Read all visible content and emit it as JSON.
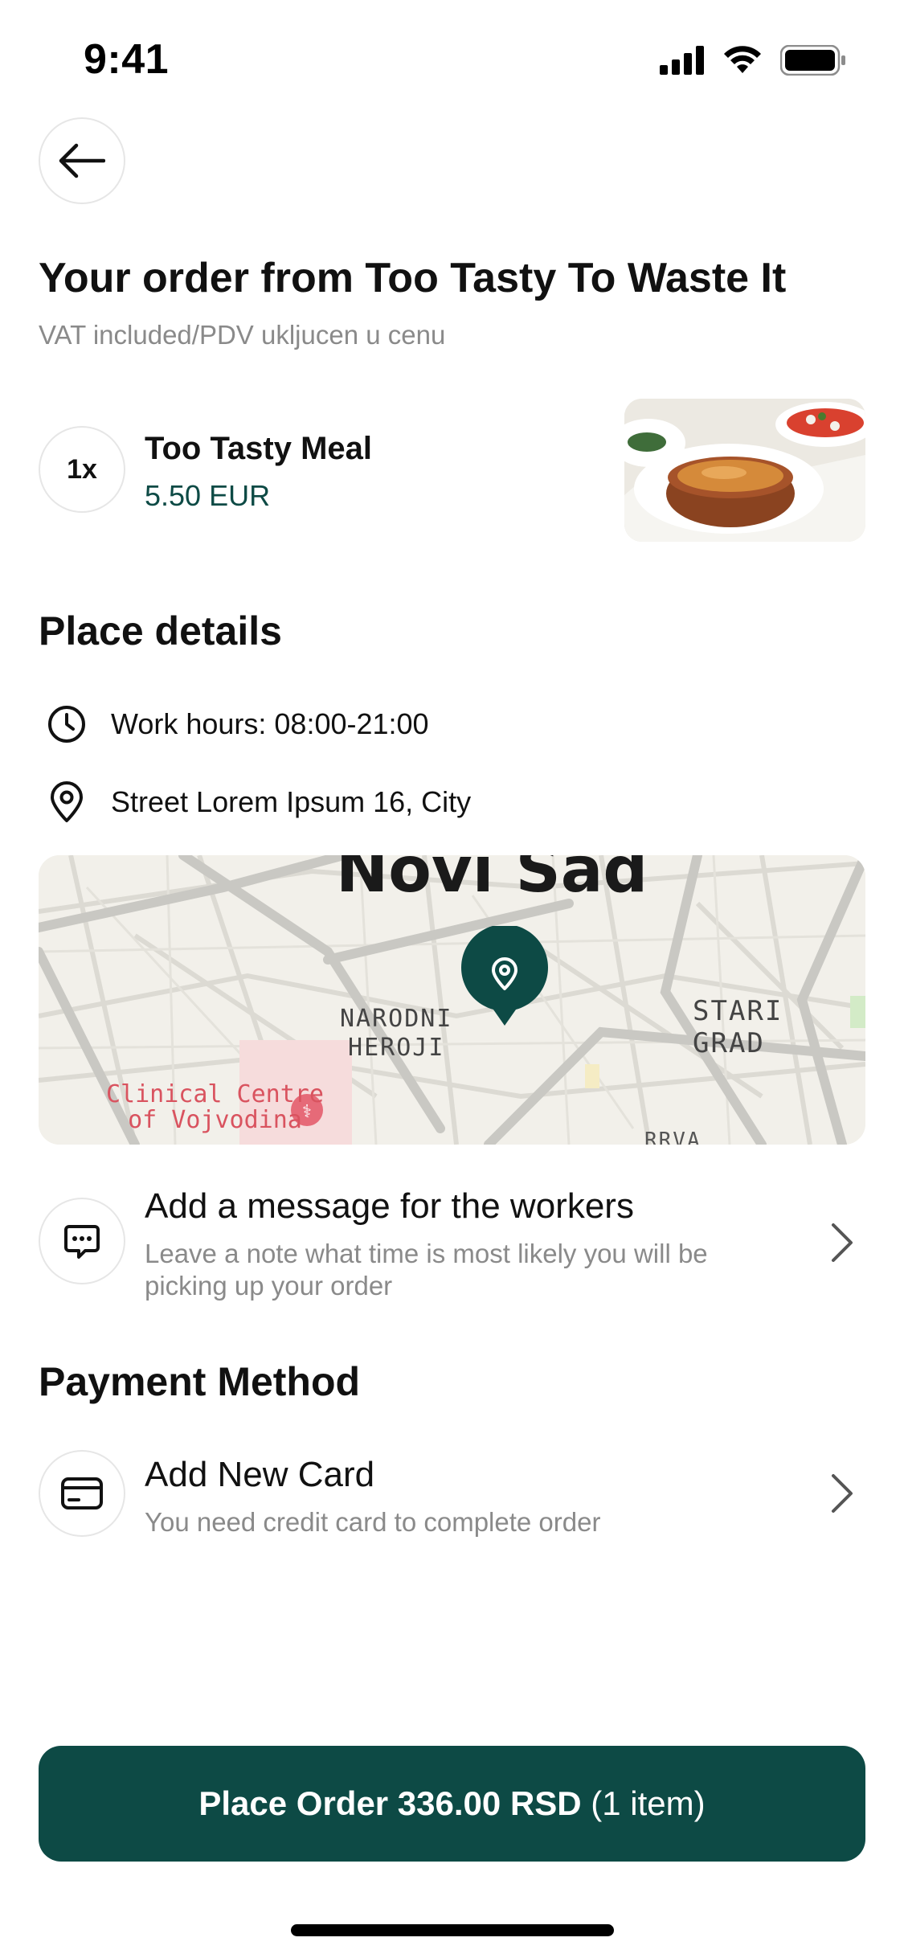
{
  "status_bar": {
    "time": "9:41"
  },
  "order": {
    "title": "Your order from Too Tasty To Waste It",
    "vat_note": "VAT included/PDV ukljucen u cenu",
    "item": {
      "qty": "1x",
      "name": "Too Tasty Meal",
      "price": "5.50 EUR"
    }
  },
  "place": {
    "heading": "Place details",
    "work_hours": "Work hours: 08:00-21:00",
    "address": "Street Lorem Ipsum 16, City",
    "map_labels": {
      "city": "Novi Sad",
      "district_1_line1": "NARODNI",
      "district_1_line2": "HEROJI",
      "district_2": "STARI GRAD",
      "poi_line1": "Clinical Centre",
      "poi_line2": "of Vojvodina",
      "partial": "RRVA"
    }
  },
  "message": {
    "title": "Add a message for the workers",
    "subtitle": "Leave a note what time is most likely you will be picking up your order"
  },
  "payment": {
    "heading": "Payment Method",
    "card_title": "Add New Card",
    "card_subtitle": "You need credit card to complete order"
  },
  "cta": {
    "label_bold": "Place Order 336.00 RSD",
    "label_rest": " (1 item)"
  },
  "colors": {
    "accent": "#0d4a45",
    "muted": "#8a8a8a",
    "border": "#e6e6e6"
  },
  "icons": [
    "back-arrow-icon",
    "clock-icon",
    "location-pin-icon",
    "chat-icon",
    "credit-card-icon",
    "chevron-right-icon"
  ]
}
